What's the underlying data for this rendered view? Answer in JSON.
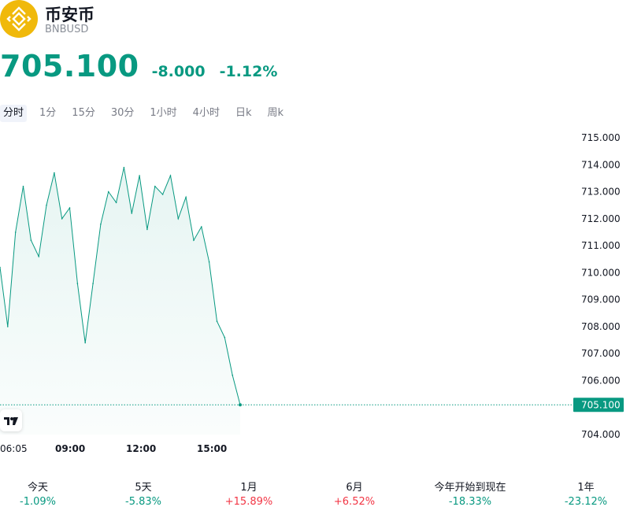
{
  "header": {
    "title": "币安币",
    "symbol": "BNBUSD",
    "price": "705.100",
    "change": "-8.000",
    "change_pct": "-1.12%",
    "brand_color": "#F0B90B",
    "down_color": "#089981",
    "up_color": "#f23645"
  },
  "tabs": [
    {
      "label": "分时",
      "active": true
    },
    {
      "label": "1分"
    },
    {
      "label": "15分"
    },
    {
      "label": "30分"
    },
    {
      "label": "1小时"
    },
    {
      "label": "4小时"
    },
    {
      "label": "日k"
    },
    {
      "label": "周k"
    }
  ],
  "chart_data": {
    "type": "area",
    "y_ticks": [
      "715.000",
      "714.000",
      "713.000",
      "712.000",
      "711.000",
      "710.000",
      "709.000",
      "708.000",
      "707.000",
      "706.000",
      "704.000"
    ],
    "x_ticks": [
      "06:05",
      "09:00",
      "12:00",
      "15:00"
    ],
    "ylim": [
      704,
      715
    ],
    "last_value": 705.1,
    "last_label": "705.100",
    "line_color": "#089981",
    "series": [
      {
        "x": [
          "06:05",
          "06:25",
          "06:45",
          "07:05",
          "07:25",
          "07:45",
          "08:05",
          "08:25",
          "08:45",
          "09:05",
          "09:25",
          "09:45",
          "10:05",
          "10:25",
          "10:45",
          "11:05",
          "11:25",
          "11:45",
          "12:05",
          "12:25",
          "12:45",
          "13:05",
          "13:25",
          "13:45",
          "14:05",
          "14:25",
          "14:45",
          "15:05",
          "15:25",
          "15:45",
          "16:05",
          "16:25"
        ],
        "values": [
          710.2,
          708.0,
          711.5,
          713.2,
          711.2,
          710.6,
          712.5,
          713.7,
          712.0,
          712.4,
          709.6,
          707.4,
          709.6,
          711.8,
          713.0,
          712.6,
          713.9,
          712.2,
          713.6,
          711.6,
          713.2,
          712.9,
          713.6,
          712.0,
          712.8,
          711.2,
          711.7,
          710.4,
          708.2,
          707.6,
          706.2,
          705.1
        ]
      }
    ]
  },
  "periods": [
    {
      "label": "今天",
      "value": "-1.09%",
      "dir": "neg"
    },
    {
      "label": "5天",
      "value": "-5.83%",
      "dir": "neg"
    },
    {
      "label": "1月",
      "value": "+15.89%",
      "dir": "pos"
    },
    {
      "label": "6月",
      "value": "+6.52%",
      "dir": "pos"
    },
    {
      "label": "今年开始到现在",
      "value": "-18.33%",
      "dir": "neg"
    },
    {
      "label": "1年",
      "value": "-23.12%",
      "dir": "neg"
    }
  ],
  "icons": {
    "logo": "bnb-logo-icon",
    "tv": "tradingview-logo-icon"
  }
}
